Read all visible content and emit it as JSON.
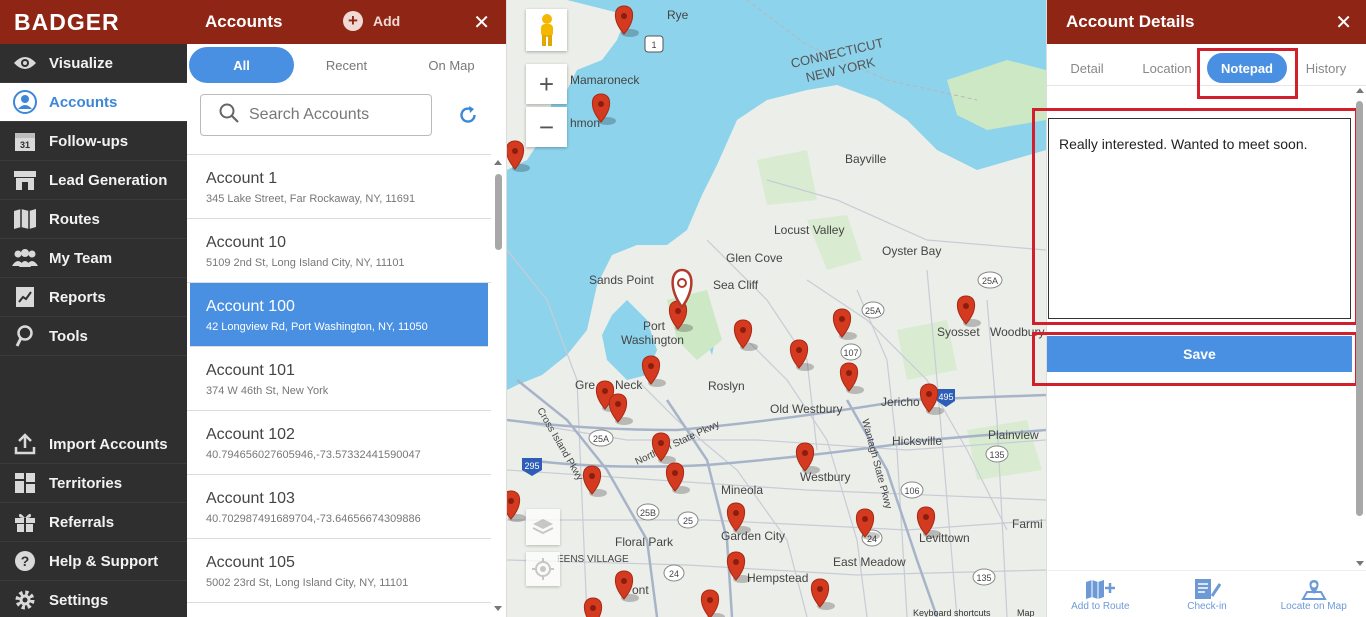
{
  "sidebar": {
    "brand": "BADGER",
    "items": [
      {
        "label": "Visualize",
        "icon": "eye-icon"
      },
      {
        "label": "Accounts",
        "icon": "account-icon",
        "active": true
      },
      {
        "label": "Follow-ups",
        "icon": "calendar-icon"
      },
      {
        "label": "Lead Generation",
        "icon": "store-icon"
      },
      {
        "label": "Routes",
        "icon": "map-icon"
      },
      {
        "label": "My Team",
        "icon": "team-icon"
      },
      {
        "label": "Reports",
        "icon": "reports-icon"
      },
      {
        "label": "Tools",
        "icon": "tools-icon"
      }
    ],
    "bottom_items": [
      {
        "label": "Import Accounts",
        "icon": "upload-icon"
      },
      {
        "label": "Territories",
        "icon": "territories-icon"
      },
      {
        "label": "Referrals",
        "icon": "gift-icon"
      },
      {
        "label": "Help & Support",
        "icon": "help-icon"
      },
      {
        "label": "Settings",
        "icon": "gear-icon"
      }
    ],
    "calendar_day": "31"
  },
  "accounts_panel": {
    "title": "Accounts",
    "add_label": "Add",
    "close": "✕",
    "tabs": [
      {
        "label": "All",
        "active": true
      },
      {
        "label": "Recent"
      },
      {
        "label": "On Map"
      }
    ],
    "search_placeholder": "Search Accounts",
    "accounts": [
      {
        "name": "Account 1",
        "address": "345 Lake Street, Far Rockaway, NY, 11691"
      },
      {
        "name": "Account 10",
        "address": "5109 2nd St, Long Island City, NY, 11101"
      },
      {
        "name": "Account 100",
        "address": "42 Longview Rd, Port Washington, NY, 11050",
        "selected": true
      },
      {
        "name": "Account 101",
        "address": "374 W 46th St, New York"
      },
      {
        "name": "Account 102",
        "address": "40.794656027605946,-73.57332441590047"
      },
      {
        "name": "Account 103",
        "address": "40.702987491689704,-73.64656674309886"
      },
      {
        "name": "Account 105",
        "address": "5002 23rd St, Long Island City, NY, 11101"
      }
    ]
  },
  "map": {
    "labels": [
      {
        "text": "Rye"
      },
      {
        "text": "Mamaroneck"
      },
      {
        "text": "CONNECTICUT"
      },
      {
        "text": "NEW YORK"
      },
      {
        "text": "Bayville"
      },
      {
        "text": "Locust Valley"
      },
      {
        "text": "Glen Cove"
      },
      {
        "text": "Oyster Bay"
      },
      {
        "text": "Sands Point"
      },
      {
        "text": "Sea Cliff"
      },
      {
        "text": "Port"
      },
      {
        "text": "Washington"
      },
      {
        "text": "Syosset"
      },
      {
        "text": "Woodbury"
      },
      {
        "text": "Roslyn"
      },
      {
        "text": "Old Westbury"
      },
      {
        "text": "Jericho"
      },
      {
        "text": "Hicksville"
      },
      {
        "text": "Plainview"
      },
      {
        "text": "Westbury"
      },
      {
        "text": "Mineola"
      },
      {
        "text": "Garden City"
      },
      {
        "text": "Floral Park"
      },
      {
        "text": "Hempstead"
      },
      {
        "text": "East Meadow"
      },
      {
        "text": "Levittown"
      },
      {
        "text": "Farmi"
      },
      {
        "text": "EENS VILLAGE"
      },
      {
        "text": "Gre"
      },
      {
        "text": "Neck"
      },
      {
        "text": "hmon"
      },
      {
        "text": "ont"
      },
      {
        "text": "Cross Island Pkwy"
      },
      {
        "text": "Northern State Pkwy"
      },
      {
        "text": "Wantagh State Pkwy"
      },
      {
        "text": "Keyboard shortcuts"
      },
      {
        "text": "Map"
      }
    ],
    "shields": [
      "1",
      "25A",
      "107",
      "25A",
      "106",
      "135",
      "25",
      "25B",
      "24",
      "135",
      "295",
      "495",
      "25A",
      "24"
    ],
    "zoom_in": "+",
    "zoom_out": "−"
  },
  "details": {
    "title": "Account Details",
    "close": "✕",
    "tabs": [
      {
        "label": "Detail"
      },
      {
        "label": "Location"
      },
      {
        "label": "Notepad",
        "active": true
      },
      {
        "label": "History"
      }
    ],
    "note_text": "Really interested. Wanted to meet soon.",
    "save_label": "Save",
    "footer": [
      {
        "label": "Add to Route",
        "icon": "add-route-icon"
      },
      {
        "label": "Check-in",
        "icon": "checkin-icon"
      },
      {
        "label": "Locate on Map",
        "icon": "locate-icon"
      }
    ]
  },
  "colors": {
    "brand": "#8f2514",
    "accent": "#4a90e2",
    "sidebar_bg": "#2f2f2f",
    "highlight_box": "#d11f2c",
    "water": "#8dd3ec",
    "pin": "#d33a1f"
  }
}
